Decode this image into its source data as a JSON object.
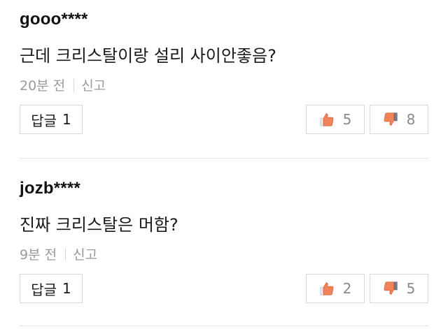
{
  "comments": [
    {
      "username": "gooo****",
      "text": "근데 크리스탈이랑 설리 사이안좋음?",
      "time": "20분 전",
      "report_label": "신고",
      "reply_label": "답글",
      "reply_count": "1",
      "likes": "5",
      "dislikes": "8"
    },
    {
      "username": "jozb****",
      "text": "진짜 크리스탈은 머함?",
      "time": "9분 전",
      "report_label": "신고",
      "reply_label": "답글",
      "reply_count": "1",
      "likes": "2",
      "dislikes": "5"
    }
  ],
  "icons": {
    "like": "thumbs-up-icon",
    "dislike": "thumbs-down-icon"
  },
  "colors": {
    "like_icon": "#f0845a",
    "dislike_icon": "#f0845a",
    "muted_text": "#9a9a9a",
    "border": "#d9d9d9"
  }
}
